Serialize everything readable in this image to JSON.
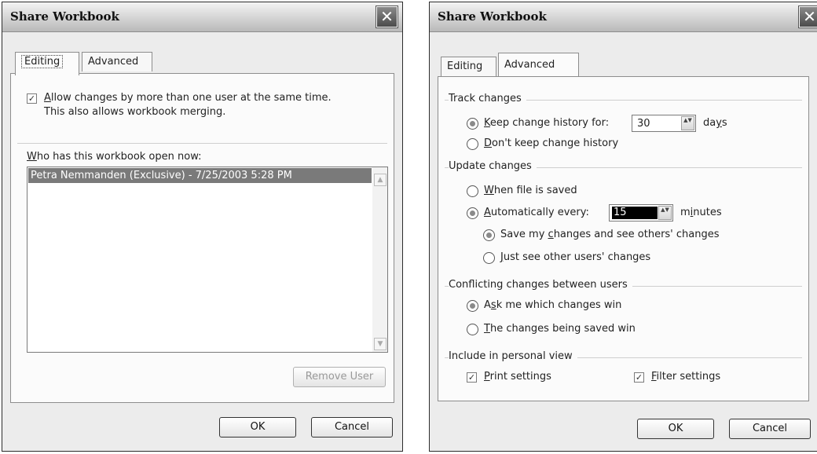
{
  "editing_dialog": {
    "title": "Share Workbook",
    "close_symbol": "✕",
    "tabs": [
      {
        "label": "Editing"
      },
      {
        "label": "Advanced"
      }
    ],
    "allow_changes": {
      "checked": true,
      "check_mark": "✓",
      "line1_underlined": "A",
      "line1_rest": "llow changes by more than one user at the same time.",
      "line2": "This also allows workbook merging."
    },
    "who_has_open": {
      "underlined": "W",
      "rest": "ho has this workbook open now:"
    },
    "users": [
      "Petra Nemmanden (Exclusive) - 7/25/2003 5:28 PM"
    ],
    "scroll_up_symbol": "▲",
    "scroll_down_symbol": "▼",
    "remove_user_label": "Remove User",
    "ok_label": "OK",
    "cancel_label": "Cancel"
  },
  "advanced_dialog": {
    "title": "Share Workbook",
    "close_symbol": "✕",
    "tabs": [
      {
        "label": "Editing"
      },
      {
        "label": "Advanced"
      }
    ],
    "track_changes": {
      "group_title": "Track changes",
      "keep_history": {
        "underlined": "K",
        "rest": "eep change history for:",
        "value": "30",
        "unit_prefix": "da",
        "unit_underlined": "y",
        "unit_suffix": "s",
        "selected": true
      },
      "dont_keep": {
        "underlined": "D",
        "rest": "on't keep change history",
        "selected": false
      }
    },
    "update_changes": {
      "group_title": "Update changes",
      "when_saved": {
        "underlined": "W",
        "rest": "hen file is saved",
        "selected": false
      },
      "automatically": {
        "underlined": "A",
        "rest": "utomatically every:",
        "value": "15",
        "unit_prefix": "m",
        "unit_underlined": "i",
        "unit_suffix": "nutes",
        "selected": true
      },
      "save_mine": {
        "prefix": "Save my ",
        "underlined": "c",
        "rest": "hanges and see others' changes",
        "selected": true
      },
      "just_see": {
        "underlined": "J",
        "rest": "ust see other users' changes",
        "selected": false
      }
    },
    "conflicting": {
      "group_title": "Conflicting changes between users",
      "ask_me": {
        "prefix": "A",
        "underlined": "s",
        "rest": "k me which changes win",
        "selected": true
      },
      "being_saved": {
        "underlined": "T",
        "rest": "he changes being saved win",
        "selected": false
      }
    },
    "personal_view": {
      "group_title": "Include in personal view",
      "print_settings": {
        "underlined": "P",
        "rest": "rint settings",
        "checked": true
      },
      "filter_settings": {
        "underlined": "F",
        "rest": "ilter settings",
        "checked": true
      },
      "check_mark": "✓"
    },
    "spin_symbol": "▲▼",
    "ok_label": "OK",
    "cancel_label": "Cancel"
  }
}
